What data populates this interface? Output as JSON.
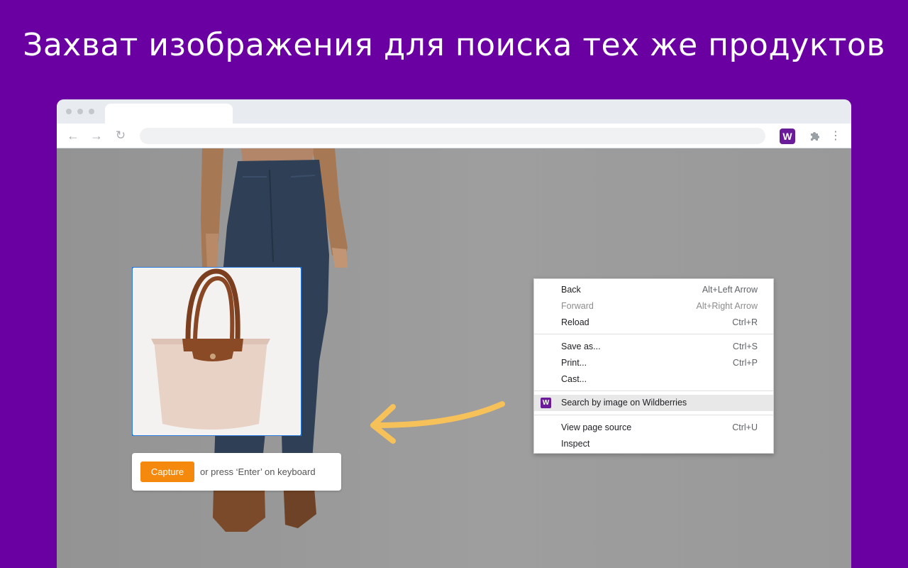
{
  "headline": "Захват изображения для поиска тех же продуктов",
  "colors": {
    "background": "#6a00a2",
    "extension_brand": "#6a1b9a",
    "capture_button": "#f5890e",
    "selection_border": "#2a7de1",
    "arrow": "#f7c15a"
  },
  "browser": {
    "toolbar": {
      "back_icon": "←",
      "forward_icon": "→",
      "reload_icon": "↻",
      "extension_badge": "W",
      "menu_icon": "⋮"
    }
  },
  "capture": {
    "button_label": "Capture",
    "hint": "or press ‘Enter’ on keyboard"
  },
  "context_menu": {
    "items": [
      {
        "label": "Back",
        "shortcut": "Alt+Left Arrow"
      },
      {
        "label": "Forward",
        "shortcut": "Alt+Right Arrow"
      },
      {
        "label": "Reload",
        "shortcut": "Ctrl+R"
      },
      {
        "label": "Save as...",
        "shortcut": "Ctrl+S"
      },
      {
        "label": "Print...",
        "shortcut": "Ctrl+P"
      },
      {
        "label": "Cast..."
      },
      {
        "label": "Search by image on Wildberries",
        "icon_text": "W"
      },
      {
        "label": "View page source",
        "shortcut": "Ctrl+U"
      },
      {
        "label": "Inspect"
      }
    ]
  }
}
